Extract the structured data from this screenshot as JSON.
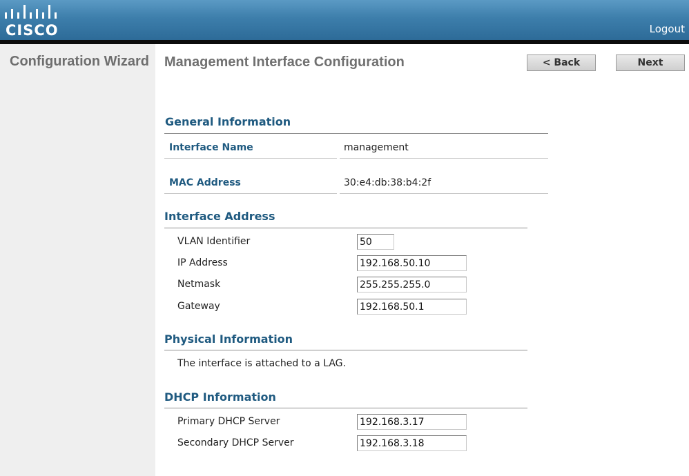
{
  "brand": {
    "logo_text": "CISCO"
  },
  "header": {
    "logout_label": "Logout"
  },
  "sidebar": {
    "title": "Configuration Wizard"
  },
  "main": {
    "title": "Management Interface Configuration",
    "back_label": "< Back",
    "next_label": "Next",
    "general": {
      "heading": "General Information",
      "interface_name_label": "Interface Name",
      "interface_name_value": "management",
      "mac_label": "MAC Address",
      "mac_value": "30:e4:db:38:b4:2f"
    },
    "interface_address": {
      "heading": "Interface Address",
      "vlan_label": "VLAN Identifier",
      "vlan_value": "50",
      "ip_label": "IP Address",
      "ip_value": "192.168.50.10",
      "netmask_label": "Netmask",
      "netmask_value": "255.255.255.0",
      "gateway_label": "Gateway",
      "gateway_value": "192.168.50.1"
    },
    "physical": {
      "heading": "Physical Information",
      "text": "The interface is attached to a LAG."
    },
    "dhcp": {
      "heading": "DHCP Information",
      "primary_label": "Primary DHCP Server",
      "primary_value": "192.168.3.17",
      "secondary_label": "Secondary DHCP Server",
      "secondary_value": "192.168.3.18"
    }
  },
  "colors": {
    "header_blue": "#3d7eab",
    "section_heading": "#1f5a80",
    "sidebar_bg": "#efefef"
  }
}
